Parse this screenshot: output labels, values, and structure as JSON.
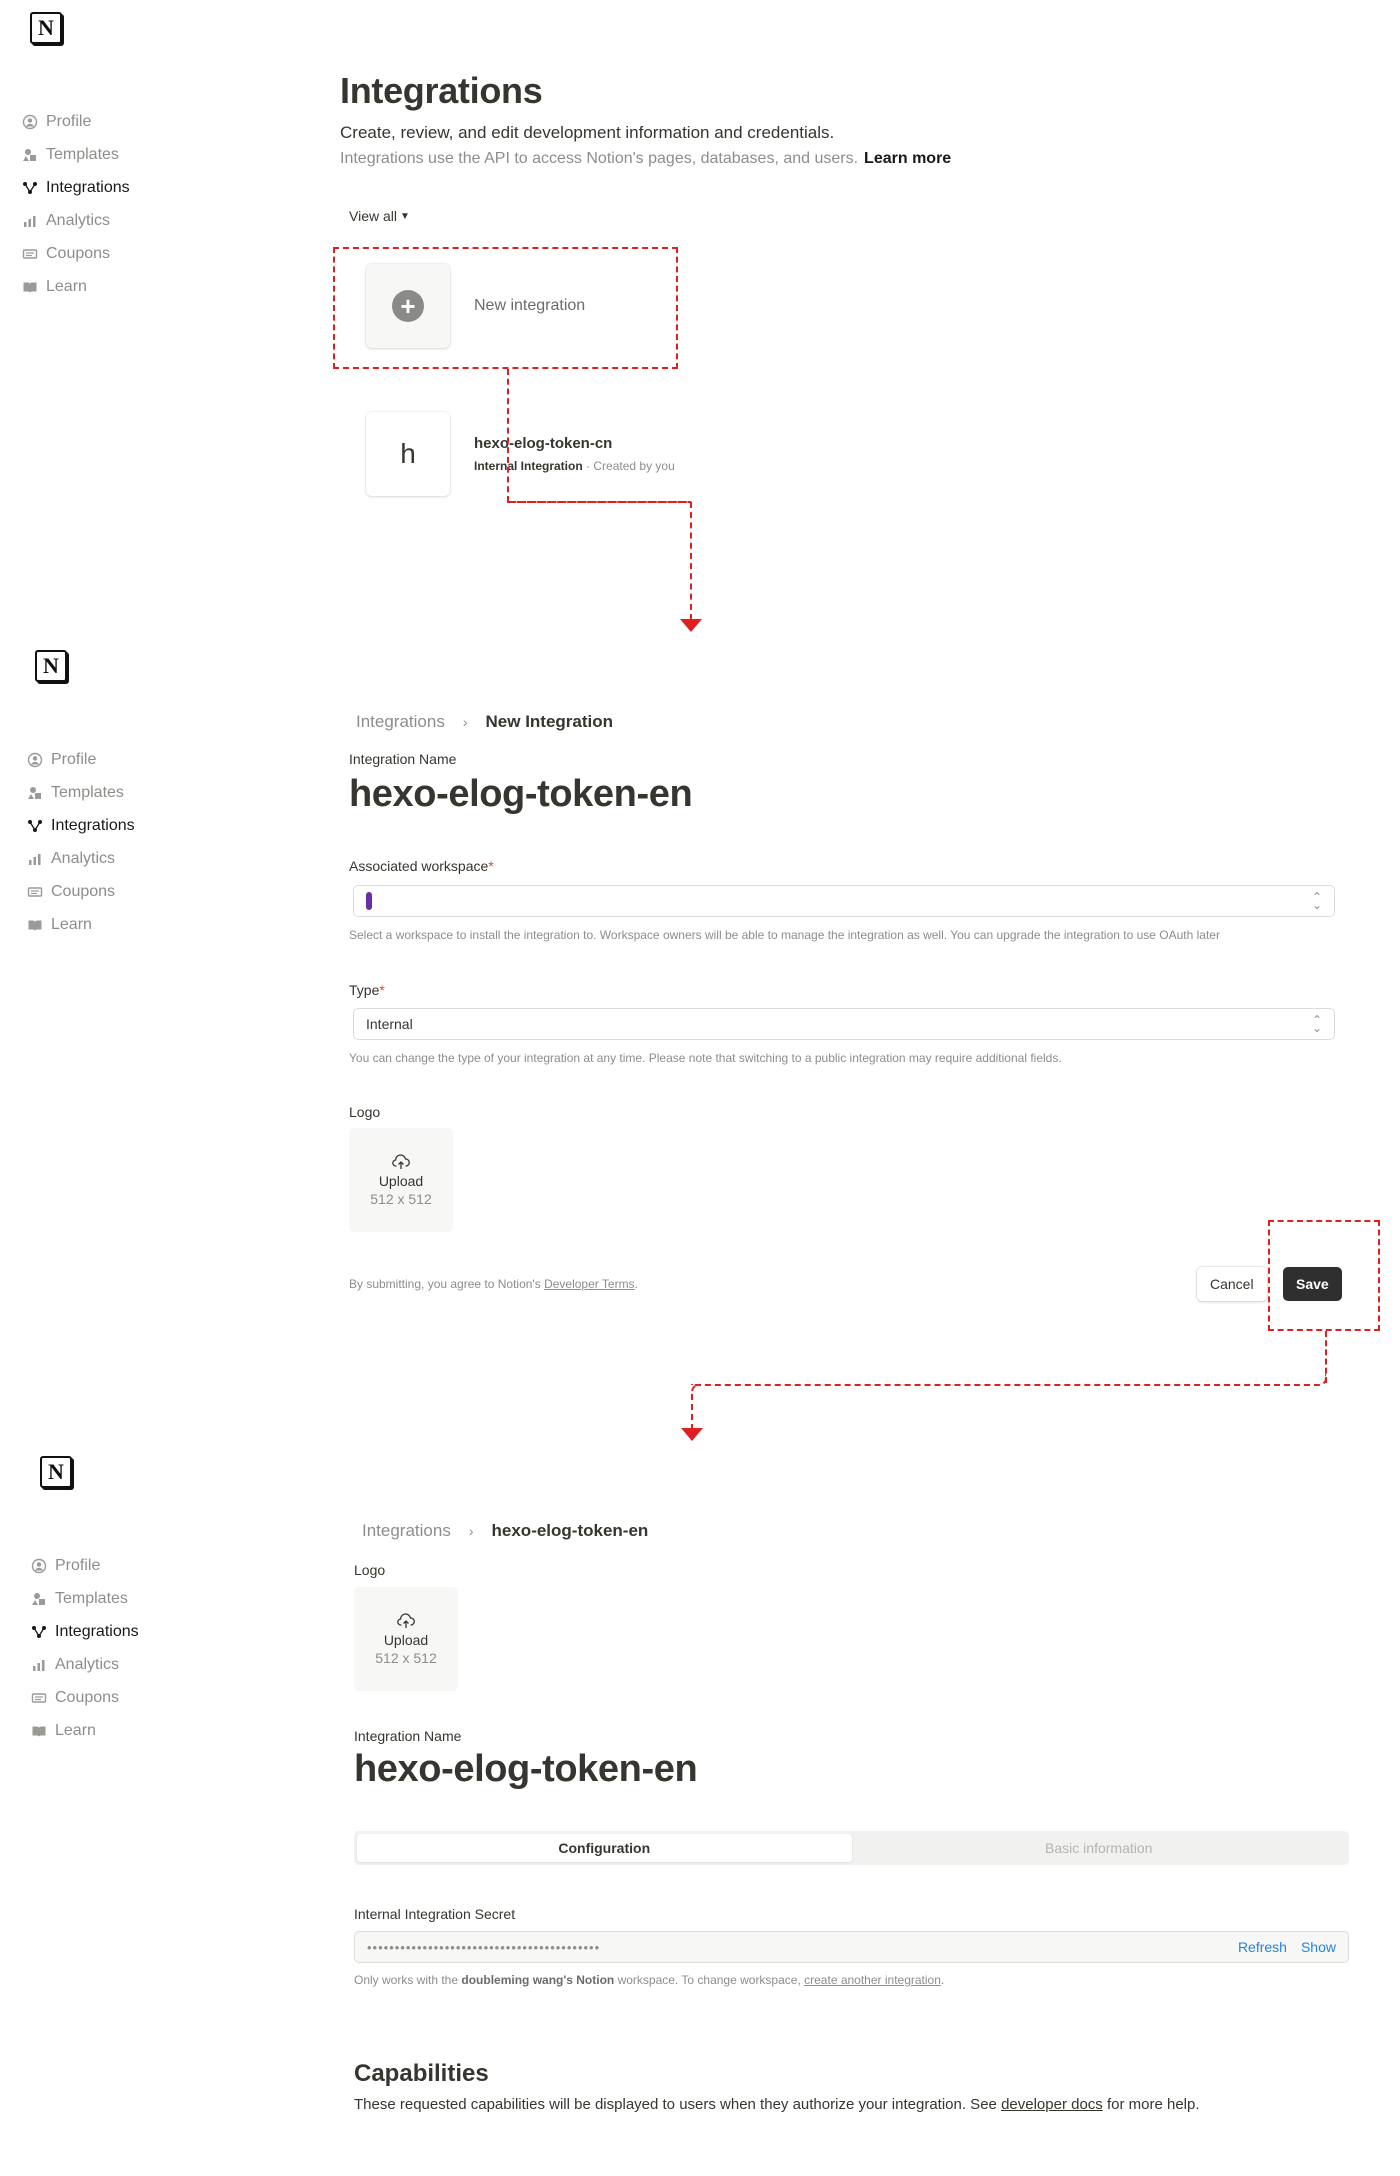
{
  "nav": [
    "Profile",
    "Templates",
    "Integrations",
    "Analytics",
    "Coupons",
    "Learn"
  ],
  "nav_active": "Integrations",
  "panel1": {
    "title": "Integrations",
    "subtitle": "Create, review, and edit development information and credentials.",
    "subtitle2": "Integrations use the API to access Notion's pages, databases, and users.",
    "learn_more": "Learn more",
    "view_all": "View all",
    "new_integration": "New integration",
    "existing": {
      "letter": "h",
      "name": "hexo-elog-token-cn",
      "type": "Internal Integration",
      "sep": "·",
      "created": "Created by you"
    }
  },
  "panel2": {
    "crumb_root": "Integrations",
    "crumb_current": "New Integration",
    "name_label": "Integration Name",
    "name_value": "hexo-elog-token-en",
    "workspace_label": "Associated workspace",
    "workspace_hint": "Select a workspace to install the integration to. Workspace owners will be able to manage the integration as well. You can upgrade the integration to use OAuth later",
    "type_label": "Type",
    "type_value": "Internal",
    "type_hint": "You can change the type of your integration at any time. Please note that switching to a public integration may require additional fields.",
    "logo_label": "Logo",
    "upload": "Upload",
    "upload_size": "512 x 512",
    "terms_prefix": "By submitting, you agree to Notion's",
    "terms_link": "Developer Terms",
    "terms_suffix": ".",
    "cancel": "Cancel",
    "save": "Save"
  },
  "panel3": {
    "crumb_root": "Integrations",
    "crumb_current": "hexo-elog-token-en",
    "logo_label": "Logo",
    "upload": "Upload",
    "upload_size": "512 x 512",
    "name_label": "Integration Name",
    "name_value": "hexo-elog-token-en",
    "tab_config": "Configuration",
    "tab_basic": "Basic information",
    "secret_label": "Internal Integration Secret",
    "secret_mask": "••••••••••••••••••••••••••••••••••••••••••",
    "refresh": "Refresh",
    "show": "Show",
    "hint_prefix": "Only works with the",
    "hint_workspace": "doubleming wang's Notion",
    "hint_middle": "workspace. To change workspace,",
    "hint_link": "create another integration",
    "hint_suffix": ".",
    "cap_title": "Capabilities",
    "cap_sub_prefix": "These requested capabilities will be displayed to users when they authorize your integration. See",
    "cap_link": "developer docs",
    "cap_sub_suffix": "for more help."
  },
  "colors": {
    "annotation_red": "#e02020",
    "link_blue": "#2383e2",
    "required_red": "#e03e3e",
    "workspace_purple": "#6b2fa5"
  }
}
